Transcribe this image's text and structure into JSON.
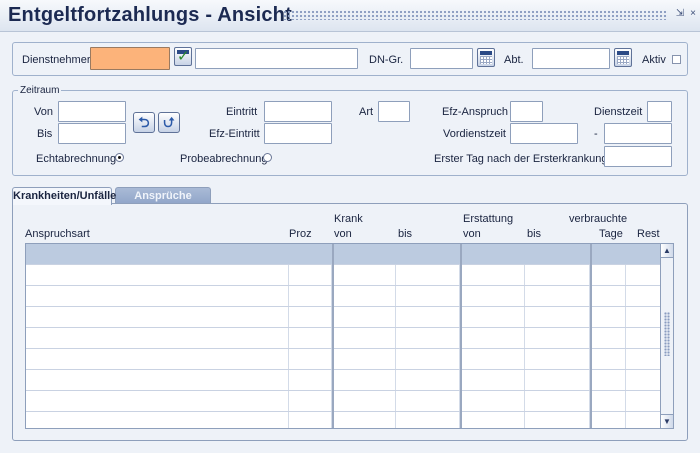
{
  "window": {
    "title": "Entgeltfortzahlungs - Ansicht",
    "minimize_glyph": "⇲",
    "close_glyph": "×"
  },
  "header": {
    "dienstnehmer_label": "Dienstnehmer",
    "dienstnehmer_value": "",
    "dienstnehmer_name": "",
    "dngr_label": "DN-Gr.",
    "dngr_value": "",
    "abt_label": "Abt.",
    "abt_value": "",
    "aktiv_label": "Aktiv",
    "aktiv_checked": false
  },
  "zeitraum": {
    "legend": "Zeitraum",
    "von_label": "Von",
    "von_value": "",
    "bis_label": "Bis",
    "bis_value": "",
    "prev_glyph": "⮌",
    "next_glyph": "⮍",
    "eintritt_label": "Eintritt",
    "eintritt_value": "",
    "efz_eintritt_label": "Efz-Eintritt",
    "efz_eintritt_value": "",
    "art_label": "Art",
    "art_value": "",
    "efz_anspruch_label": "Efz-Anspruch",
    "efz_anspruch_value": "",
    "vordienstzeit_label": "Vordienstzeit",
    "vordienstzeit_value": "",
    "dienstzeit_label": "Dienstzeit",
    "dienstzeit_value": "",
    "dash": "-",
    "dienstzeit_to_value": "",
    "echtabrechnung_label": "Echtabrechnung",
    "echtabrechnung_selected": true,
    "probeabrechnung_label": "Probeabrechnung",
    "probeabrechnung_selected": false,
    "erster_tag_label": "Erster Tag nach der Ersterkrankung",
    "erster_tag_value": ""
  },
  "tabs": [
    {
      "label": "Krankheiten/Unfälle",
      "active": true
    },
    {
      "label": "Ansprüche",
      "active": false
    }
  ],
  "table": {
    "group_headers": {
      "krank": "Krank",
      "erstattung": "Erstattung",
      "verbrauchte": "verbrauchte"
    },
    "columns": {
      "anspruchsart": "Anspruchsart",
      "proz": "Proz",
      "krank_von": "von",
      "krank_bis": "bis",
      "erstattung_von": "von",
      "erstattung_bis": "bis",
      "tage": "Tage",
      "rest": "Rest"
    },
    "rows": [
      [
        "",
        "",
        "",
        "",
        "",
        "",
        "",
        ""
      ],
      [
        "",
        "",
        "",
        "",
        "",
        "",
        "",
        ""
      ],
      [
        "",
        "",
        "",
        "",
        "",
        "",
        "",
        ""
      ],
      [
        "",
        "",
        "",
        "",
        "",
        "",
        "",
        ""
      ],
      [
        "",
        "",
        "",
        "",
        "",
        "",
        "",
        ""
      ],
      [
        "",
        "",
        "",
        "",
        "",
        "",
        "",
        ""
      ],
      [
        "",
        "",
        "",
        "",
        "",
        "",
        "",
        ""
      ],
      [
        "",
        "",
        "",
        "",
        "",
        "",
        "",
        ""
      ]
    ]
  },
  "scrollbar": {
    "up_glyph": "▲",
    "down_glyph": "▼"
  },
  "colors": {
    "active_field": "#fcb37a",
    "header_row": "#bccbe0",
    "title_text": "#1c2a52"
  }
}
